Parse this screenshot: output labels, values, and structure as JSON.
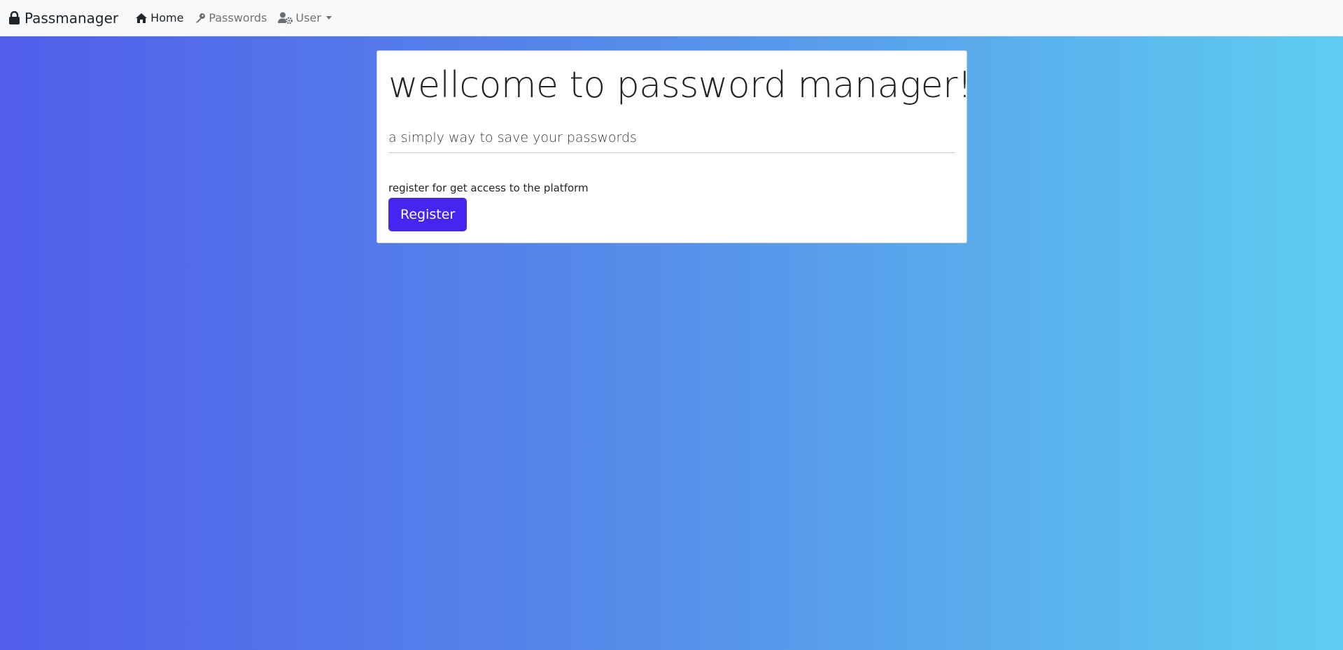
{
  "navbar": {
    "brand": {
      "icon": "lock-icon",
      "label": "Passmanager"
    },
    "items": [
      {
        "icon": "home-icon",
        "label": "Home",
        "active": true
      },
      {
        "icon": "key-icon",
        "label": "Passwords",
        "active": false
      },
      {
        "icon": "user-gear-icon",
        "label": "User",
        "active": false,
        "dropdown": true
      }
    ]
  },
  "hero": {
    "title": "wellcome to password manager!",
    "subtitle": "a simply way to save your passwords",
    "note": "register for get access to the platform",
    "button_label": "Register"
  },
  "colors": {
    "gradient_start": "#515eeb",
    "gradient_end": "#5ecdf0",
    "button": "#4525ef",
    "navbar_bg": "#f8f9fa"
  }
}
